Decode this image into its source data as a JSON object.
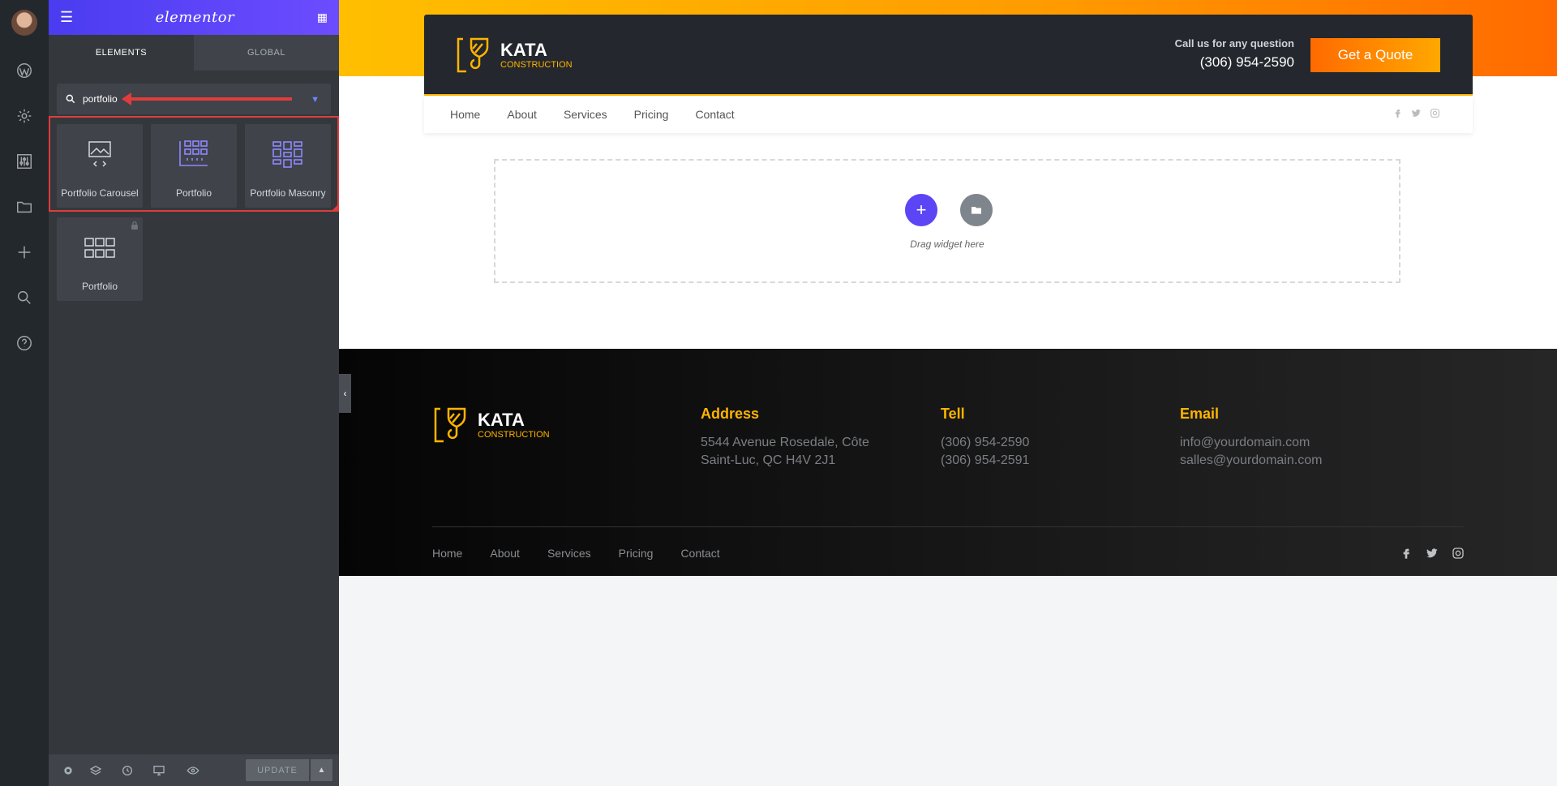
{
  "panel": {
    "logo": "elementor",
    "tabs": [
      "ELEMENTS",
      "GLOBAL"
    ],
    "search_value": "portfolio",
    "widgets": [
      {
        "label": "Portfolio Carousel",
        "locked": false
      },
      {
        "label": "Portfolio",
        "locked": false
      },
      {
        "label": "Portfolio Masonry",
        "locked": false
      },
      {
        "label": "Portfolio",
        "locked": true
      }
    ],
    "update_label": "UPDATE"
  },
  "site": {
    "brand": {
      "name": "KATA",
      "sub": "CONSTRUCTION"
    },
    "call_label": "Call us for any question",
    "phone": "(306) 954-2590",
    "quote_button": "Get a Quote",
    "nav": [
      "Home",
      "About",
      "Services",
      "Pricing",
      "Contact"
    ],
    "drop_hint": "Drag widget here"
  },
  "footer": {
    "brand": {
      "name": "KATA",
      "sub": "CONSTRUCTION"
    },
    "address": {
      "heading": "Address",
      "lines": [
        "5544 Avenue Rosedale, Côte",
        "Saint-Luc, QC H4V 2J1"
      ]
    },
    "tell": {
      "heading": "Tell",
      "lines": [
        "(306) 954-2590",
        "(306) 954-2591"
      ]
    },
    "email": {
      "heading": "Email",
      "lines": [
        "info@yourdomain.com",
        "salles@yourdomain.com"
      ]
    },
    "nav": [
      "Home",
      "About",
      "Services",
      "Pricing",
      "Contact"
    ]
  },
  "colors": {
    "accent": "#5b45f5",
    "brand_yellow": "#ffb400",
    "quote_orange": "#ff6a00"
  }
}
